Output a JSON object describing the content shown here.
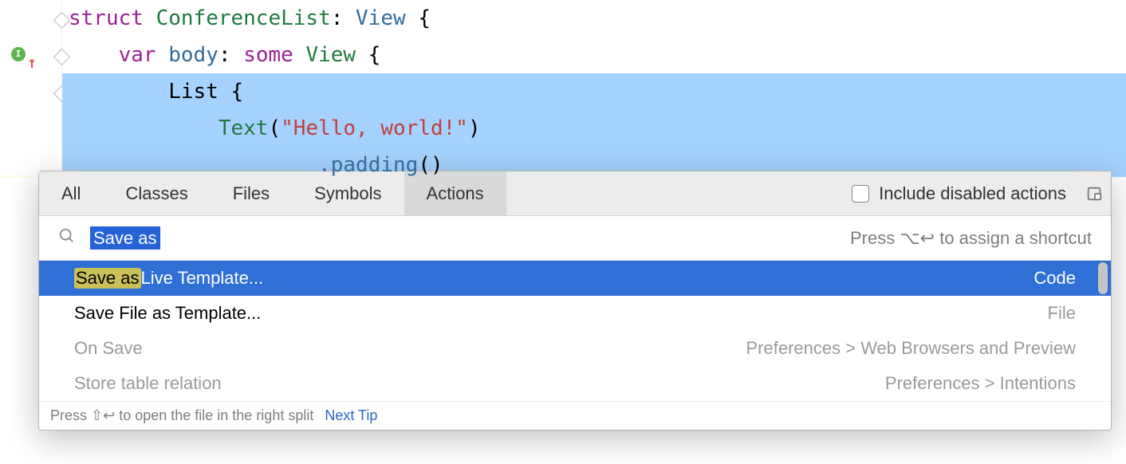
{
  "code": {
    "tokens": {
      "struct": "struct",
      "conference_list": "ConferenceList",
      "view": "View",
      "var": "var",
      "body": "body",
      "some": "some",
      "list": "List",
      "text": "Text",
      "hello": "\"Hello, world!\"",
      "padding": ".padding",
      "lbrace": "{",
      "rbrace": "}",
      "colon": ":",
      "paren_open": "(",
      "paren_close": ")"
    }
  },
  "popup": {
    "tabs": {
      "all": "All",
      "classes": "Classes",
      "files": "Files",
      "symbols": "Symbols",
      "actions": "Actions",
      "active": "actions"
    },
    "include_disabled_label": "Include disabled actions",
    "search": {
      "query": "Save as",
      "hint_prefix": "Press ",
      "hint_shortcut": "⌥↩",
      "hint_suffix": " to assign a shortcut"
    },
    "results": [
      {
        "prefix": "Save as",
        "suffix": " Live Template...",
        "category": "Code",
        "selected": true
      },
      {
        "prefix": "",
        "suffix": "Save File as Template...",
        "category": "File",
        "selected": false
      },
      {
        "prefix": "",
        "suffix": "On Save",
        "category": "Preferences > Web Browsers and Preview",
        "selected": false,
        "dim": true
      },
      {
        "prefix": "",
        "suffix": "Store table relation",
        "category": "Preferences > Intentions",
        "selected": false,
        "dim": true
      }
    ],
    "footer": {
      "text_prefix": "Press ",
      "shortcut": "⇧↩",
      "text_suffix": " to open the file in the right split",
      "next_tip": "Next Tip"
    }
  },
  "icons": {
    "gutter_letter": "I"
  }
}
